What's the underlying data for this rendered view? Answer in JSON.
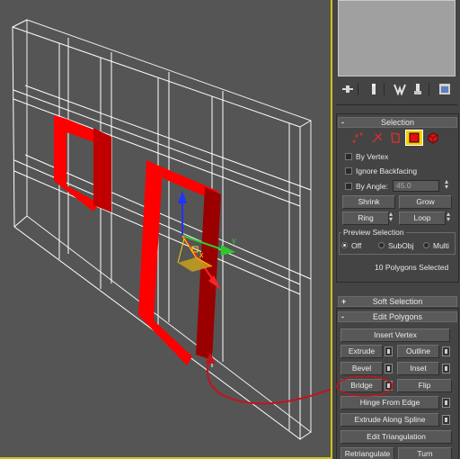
{
  "colors": {
    "viewport_bg": "#555555",
    "viewport_border": "#cfc21a",
    "panel_bg": "#444444",
    "selection_red": "#ff0000",
    "annotation_red": "#c0141e"
  },
  "tab_icons": [
    "create-tab-icon",
    "modify-tab-icon",
    "hierarchy-tab-icon",
    "motion-tab-icon",
    "display-tab-icon",
    "utilities-tab-icon"
  ],
  "selection_rollout": {
    "sign": "-",
    "title": "Selection",
    "by_vertex": "By Vertex",
    "ignore_backfacing": "Ignore Backfacing",
    "by_angle": "By Angle:",
    "angle_value": "45.0",
    "shrink": "Shrink",
    "grow": "Grow",
    "ring": "Ring",
    "loop": "Loop",
    "preview_title": "Preview Selection",
    "preview_off": "Off",
    "preview_subobj": "SubObj",
    "preview_multi": "Multi",
    "status": "10 Polygons Selected"
  },
  "soft_selection": {
    "sign": "+",
    "title": "Soft Selection"
  },
  "edit_polygons": {
    "sign": "-",
    "title": "Edit Polygons",
    "insert_vertex": "Insert Vertex",
    "extrude": "Extrude",
    "outline": "Outline",
    "bevel": "Bevel",
    "inset": "Inset",
    "bridge": "Bridge",
    "flip": "Flip",
    "hinge_from_edge": "Hinge From Edge",
    "extrude_along_spline": "Extrude Along Spline",
    "edit_triangulation": "Edit Triangulation",
    "retriangulate": "Retriangulate",
    "turn": "Turn"
  },
  "gizmo": {
    "axis_x": "x",
    "axis_y": "y"
  }
}
